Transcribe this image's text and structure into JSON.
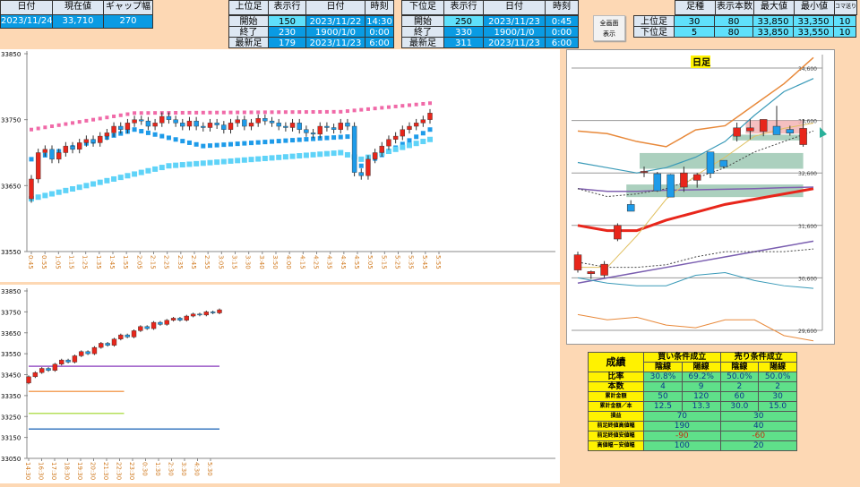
{
  "top_left": {
    "headers": [
      "日付",
      "現在値",
      "ギャップ幅"
    ],
    "values": [
      "2023/11/24",
      "33,710",
      "270"
    ]
  },
  "upper_tf": {
    "headers": [
      "上位足",
      "表示行",
      "日付",
      "時刻"
    ],
    "rows": [
      [
        "開始",
        "150",
        "2023/11/22",
        "14:30"
      ],
      [
        "終了",
        "230",
        "1900/1/0",
        "0:00"
      ],
      [
        "最新足",
        "179",
        "2023/11/23",
        "6:00"
      ]
    ]
  },
  "lower_tf": {
    "headers": [
      "下位足",
      "表示行",
      "日付",
      "時刻"
    ],
    "rows": [
      [
        "開始",
        "250",
        "2023/11/23",
        "0:45"
      ],
      [
        "終了",
        "330",
        "1900/1/0",
        "0:00"
      ],
      [
        "最新足",
        "311",
        "2023/11/23",
        "6:00"
      ]
    ]
  },
  "fullscreen_button": {
    "line1": "全画面",
    "line2": "表示"
  },
  "settings": {
    "headers": [
      "足種",
      "表示本数",
      "最大値",
      "最小値",
      "コマ送り"
    ],
    "rows": [
      [
        "上位足",
        "30",
        "80",
        "33,850",
        "33,350",
        "10"
      ],
      [
        "下位足",
        "5",
        "80",
        "33,850",
        "33,550",
        "10"
      ]
    ]
  },
  "stats": {
    "title": "成績",
    "buy": "買い条件成立",
    "sell": "売り条件成立",
    "neg": "陰線",
    "pos": "陽線",
    "rows": [
      {
        "label": "比率",
        "vals": [
          "30.8%",
          "69.2%",
          "50.0%",
          "50.0%"
        ]
      },
      {
        "label": "本数",
        "vals": [
          "4",
          "9",
          "2",
          "2"
        ]
      },
      {
        "label": "累計金額",
        "vals": [
          "50",
          "120",
          "60",
          "30"
        ]
      },
      {
        "label": "累計金額／本",
        "vals": [
          "12.5",
          "13.3",
          "30.0",
          "15.0"
        ]
      },
      {
        "label": "損益",
        "vals": [
          "70",
          "30"
        ]
      },
      {
        "label": "前足終値高値幅",
        "vals": [
          "190",
          "40"
        ]
      },
      {
        "label": "前足終値安値幅",
        "vals": [
          "-90",
          "-60"
        ]
      },
      {
        "label": "高値幅－安値幅",
        "vals": [
          "100",
          "20"
        ]
      }
    ]
  },
  "chart_data": [
    {
      "type": "candlestick",
      "name": "5min-chart",
      "ylim": [
        33550,
        33850
      ],
      "yticks": [
        "33850",
        "33750",
        "33650",
        "33550"
      ],
      "xticks": [
        "0:45",
        "0:55",
        "1:05",
        "1:15",
        "1:25",
        "1:35",
        "1:45",
        "1:55",
        "2:05",
        "2:15",
        "2:25",
        "2:35",
        "2:45",
        "2:55",
        "3:05",
        "3:15",
        "3:30",
        "3:40",
        "3:50",
        "4:00",
        "4:15",
        "4:25",
        "4:35",
        "4:45",
        "4:55",
        "5:05",
        "5:15",
        "5:25",
        "5:35",
        "5:45",
        "5:55"
      ],
      "closes": [
        33660,
        33700,
        33705,
        33690,
        33700,
        33710,
        33705,
        33715,
        33720,
        33715,
        33725,
        33730,
        33740,
        33735,
        33745,
        33750,
        33748,
        33740,
        33745,
        33755,
        33750,
        33745,
        33740,
        33748,
        33740,
        33738,
        33745,
        33742,
        33735,
        33745,
        33750,
        33740,
        33745,
        33752,
        33748,
        33745,
        33740,
        33738,
        33745,
        33735,
        33730,
        33728,
        33740,
        33738,
        33735,
        33745,
        33740,
        33670,
        33665,
        33690,
        33700,
        33710,
        33720,
        33725,
        33735,
        33740,
        33745,
        33750,
        33760
      ],
      "upper_band": [
        [
          0,
          33735
        ],
        [
          15,
          33760
        ],
        [
          45,
          33762
        ],
        [
          58,
          33775
        ]
      ],
      "mid_band": [
        [
          0,
          33690
        ],
        [
          15,
          33735
        ],
        [
          25,
          33710
        ],
        [
          47,
          33725
        ],
        [
          48,
          33680
        ],
        [
          58,
          33735
        ]
      ],
      "lower_band": [
        [
          0,
          33630
        ],
        [
          20,
          33680
        ],
        [
          45,
          33700
        ],
        [
          48,
          33690
        ],
        [
          58,
          33720
        ]
      ],
      "colors": {
        "up": "#e8261b",
        "down": "#1e9be9",
        "upper": "#f06aa8",
        "mid": "#1e9be9",
        "lower": "#5fd3f8"
      }
    },
    {
      "type": "candlestick",
      "name": "30min-chart",
      "ylim": [
        33050,
        33850
      ],
      "yticks": [
        "33850",
        "33750",
        "33650",
        "33550",
        "33450",
        "33350",
        "33250",
        "33150",
        "33050"
      ],
      "xticks": [
        "14:30",
        "16:30",
        "17:30",
        "18:30",
        "19:30",
        "20:30",
        "21:30",
        "22:30",
        "23:30",
        "0:30",
        "1:30",
        "2:30",
        "3:30",
        "4:30",
        "5:30"
      ],
      "closes": [
        33440,
        33460,
        33480,
        33470,
        33500,
        33520,
        33510,
        33540,
        33560,
        33550,
        33580,
        33600,
        33590,
        33620,
        33640,
        33630,
        33660,
        33680,
        33670,
        33700,
        33690,
        33710,
        33720,
        33710,
        33730,
        33740,
        33735,
        33750,
        33745,
        33760
      ],
      "hlines": [
        {
          "value": 33370,
          "color": "#f4a460",
          "to": 0.5
        },
        {
          "value": 33265,
          "color": "#b6e05a",
          "to": 0.5
        },
        {
          "value": 33190,
          "color": "#3a78c0",
          "to": 1
        },
        {
          "value": 33490,
          "color": "#9b59c6",
          "to": 1
        }
      ],
      "colors": {
        "up": "#e8261b",
        "down": "#1e9be9"
      }
    },
    {
      "type": "candlestick",
      "name": "daily-chart",
      "title": "日足",
      "ylim": [
        29600,
        34600
      ],
      "yticks": [
        "34,600",
        "33,600",
        "32,600",
        "31,600",
        "30,600",
        "29,600"
      ],
      "ohlc": [
        [
          30750,
          31100,
          30700,
          31040
        ],
        [
          30680,
          30740,
          30580,
          30720
        ],
        [
          30650,
          30920,
          30600,
          30860
        ],
        [
          31340,
          31640,
          31300,
          31600
        ],
        [
          32000,
          32080,
          31870,
          31870
        ],
        [
          32610,
          32720,
          32520,
          32630
        ],
        [
          32586,
          32620,
          32240,
          32260
        ],
        [
          32570,
          32580,
          32140,
          32140
        ],
        [
          32330,
          32720,
          32240,
          32600
        ],
        [
          32460,
          32600,
          32320,
          32570
        ],
        [
          33000,
          33000,
          32500,
          32590
        ],
        [
          32840,
          32840,
          32690,
          32720
        ],
        [
          33300,
          33560,
          33200,
          33460
        ],
        [
          33400,
          33620,
          33240,
          33460
        ],
        [
          33390,
          33620,
          33300,
          33620
        ],
        [
          33490,
          33880,
          33330,
          33330
        ],
        [
          33430,
          33500,
          33310,
          33360
        ],
        [
          33140,
          33620,
          33100,
          33450
        ]
      ],
      "lines": [
        {
          "color": "#e8893a",
          "w": 1.5,
          "pts": [
            33400,
            33350,
            33200,
            33100,
            33420,
            33500,
            33900,
            34300,
            34800
          ]
        },
        {
          "color": "#3a9ab8",
          "w": 1.2,
          "pts": [
            32800,
            32700,
            32600,
            32700,
            32900,
            33200,
            33700,
            34150,
            34400
          ]
        },
        {
          "color": "#e8261b",
          "w": 3,
          "pts": [
            31600,
            31500,
            31500,
            31700,
            31850,
            32000,
            32100,
            32200,
            32300
          ]
        },
        {
          "color": "#8060b0",
          "w": 1.5,
          "pts": [
            32300,
            32250,
            32250,
            32270,
            32280,
            32290,
            32300,
            32320,
            32330
          ]
        },
        {
          "color": "#7a5eb0",
          "w": 1.5,
          "pts": [
            30500,
            30600,
            30700,
            30800,
            30900,
            31000,
            31100,
            31200,
            31300
          ]
        },
        {
          "color": "#3a9ab8",
          "w": 1,
          "pts": [
            30600,
            30500,
            30450,
            30450,
            30650,
            30700,
            30550,
            30450,
            30400
          ]
        },
        {
          "color": "#e8893a",
          "w": 1,
          "pts": [
            29900,
            29800,
            29850,
            29700,
            29650,
            29800,
            29800,
            29500,
            29400
          ]
        },
        {
          "color": "#444",
          "w": 1,
          "dash": "2,2",
          "pts": [
            30900,
            30800,
            30800,
            30850,
            31000,
            31100,
            31100,
            31100,
            31150
          ]
        },
        {
          "color": "#444",
          "w": 1,
          "dash": "2,2",
          "pts": [
            32300,
            32150,
            32200,
            32300,
            32500,
            32700,
            33000,
            33200,
            33400
          ]
        },
        {
          "color": "#e0c060",
          "w": 1,
          "pts": [
            30800,
            30800,
            31400,
            32100,
            32550,
            32900,
            33300,
            33450,
            33550
          ]
        }
      ],
      "zones": [
        {
          "from": 33350,
          "to": 33600,
          "i0": 13,
          "i1": 17,
          "color": "#f2a9ab"
        },
        {
          "from": 32680,
          "to": 32980,
          "i0": 5,
          "i1": 17,
          "color": "#8fc0a8"
        },
        {
          "from": 32140,
          "to": 32380,
          "i0": 4,
          "i1": 17,
          "color": "#8fc0a8"
        },
        {
          "from": 33220,
          "to": 33330,
          "i0": 12,
          "i1": 17,
          "color": "#8fc0a8"
        }
      ]
    }
  ]
}
